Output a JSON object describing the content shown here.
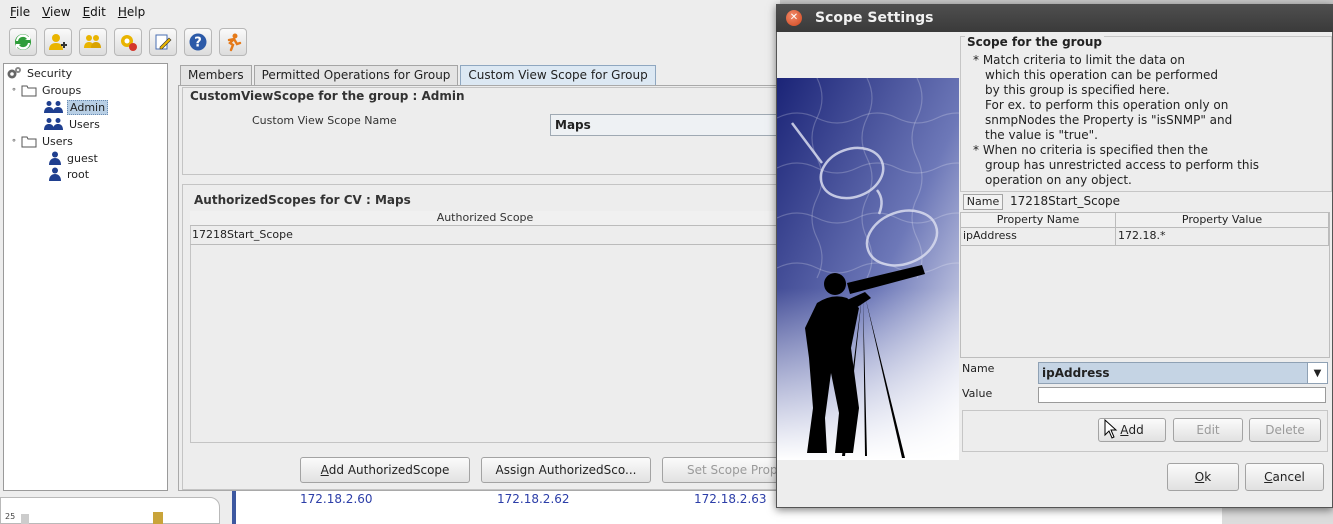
{
  "menubar": {
    "items": [
      {
        "label_pre": "",
        "mnemonic": "F",
        "label_post": "ile"
      },
      {
        "label_pre": "",
        "mnemonic": "V",
        "label_post": "iew"
      },
      {
        "label_pre": "",
        "mnemonic": "E",
        "label_post": "dit"
      },
      {
        "label_pre": "",
        "mnemonic": "H",
        "label_post": "elp"
      }
    ]
  },
  "toolbar": {
    "icons": [
      "refresh-icon",
      "add-user-icon",
      "add-group-icon",
      "operations-icon",
      "edit-icon",
      "help-icon",
      "exit-icon"
    ]
  },
  "tree": {
    "root": "Security",
    "groups_label": "Groups",
    "group_items": [
      "Admin",
      "Users"
    ],
    "users_label": "Users",
    "user_items": [
      "guest",
      "root"
    ]
  },
  "tabs": [
    "Members",
    "Permitted Operations for Group",
    "Custom View Scope for Group"
  ],
  "cvs": {
    "title": "CustomViewScope for  the group : Admin",
    "name_label": "Custom View Scope Name",
    "name_value": "Maps"
  },
  "authorized": {
    "title": "AuthorizedScopes for CV : Maps",
    "column": "Authorized Scope",
    "rows": [
      "17218Start_Scope"
    ]
  },
  "main_buttons": {
    "add_pre": "",
    "add_mn": "A",
    "add_post": "dd AuthorizedScope",
    "assign": "Assign AuthorizedSco...",
    "set_scope": "Set Scope Prop"
  },
  "background": {
    "ips": [
      "172.18.2.60",
      "172.18.2.62",
      "172.18.2.63"
    ],
    "counter": "25"
  },
  "dialog": {
    "title": "Scope Settings",
    "close_glyph": "✕",
    "group_title": "Scope for the group",
    "help_lines": [
      "*  Match criteria to limit the data on",
      "which this operation can be performed",
      "by this group is specified here.",
      "For ex. to perform this operation only on",
      "snmpNodes the Property is \"isSNMP\" and",
      "the value is \"true\".",
      "*  When no criteria is specified then the",
      "group has unrestricted access to perform this",
      "operation on any object."
    ],
    "name_tag": "Name",
    "name_value": "17218Start_Scope",
    "columns": [
      "Property Name",
      "Property Value"
    ],
    "rows": [
      [
        "ipAddress",
        "172.18.*"
      ]
    ],
    "name_label": "Name",
    "value_label": "Value",
    "selected_property": "ipAddress",
    "value_input": "",
    "btn_add_mn": "A",
    "btn_add_post": "dd",
    "btn_edit": "Edit",
    "btn_delete": "Delete",
    "btn_ok_mn": "O",
    "btn_ok_post": "k",
    "btn_cancel_mn": "C",
    "btn_cancel_post": "ancel"
  }
}
